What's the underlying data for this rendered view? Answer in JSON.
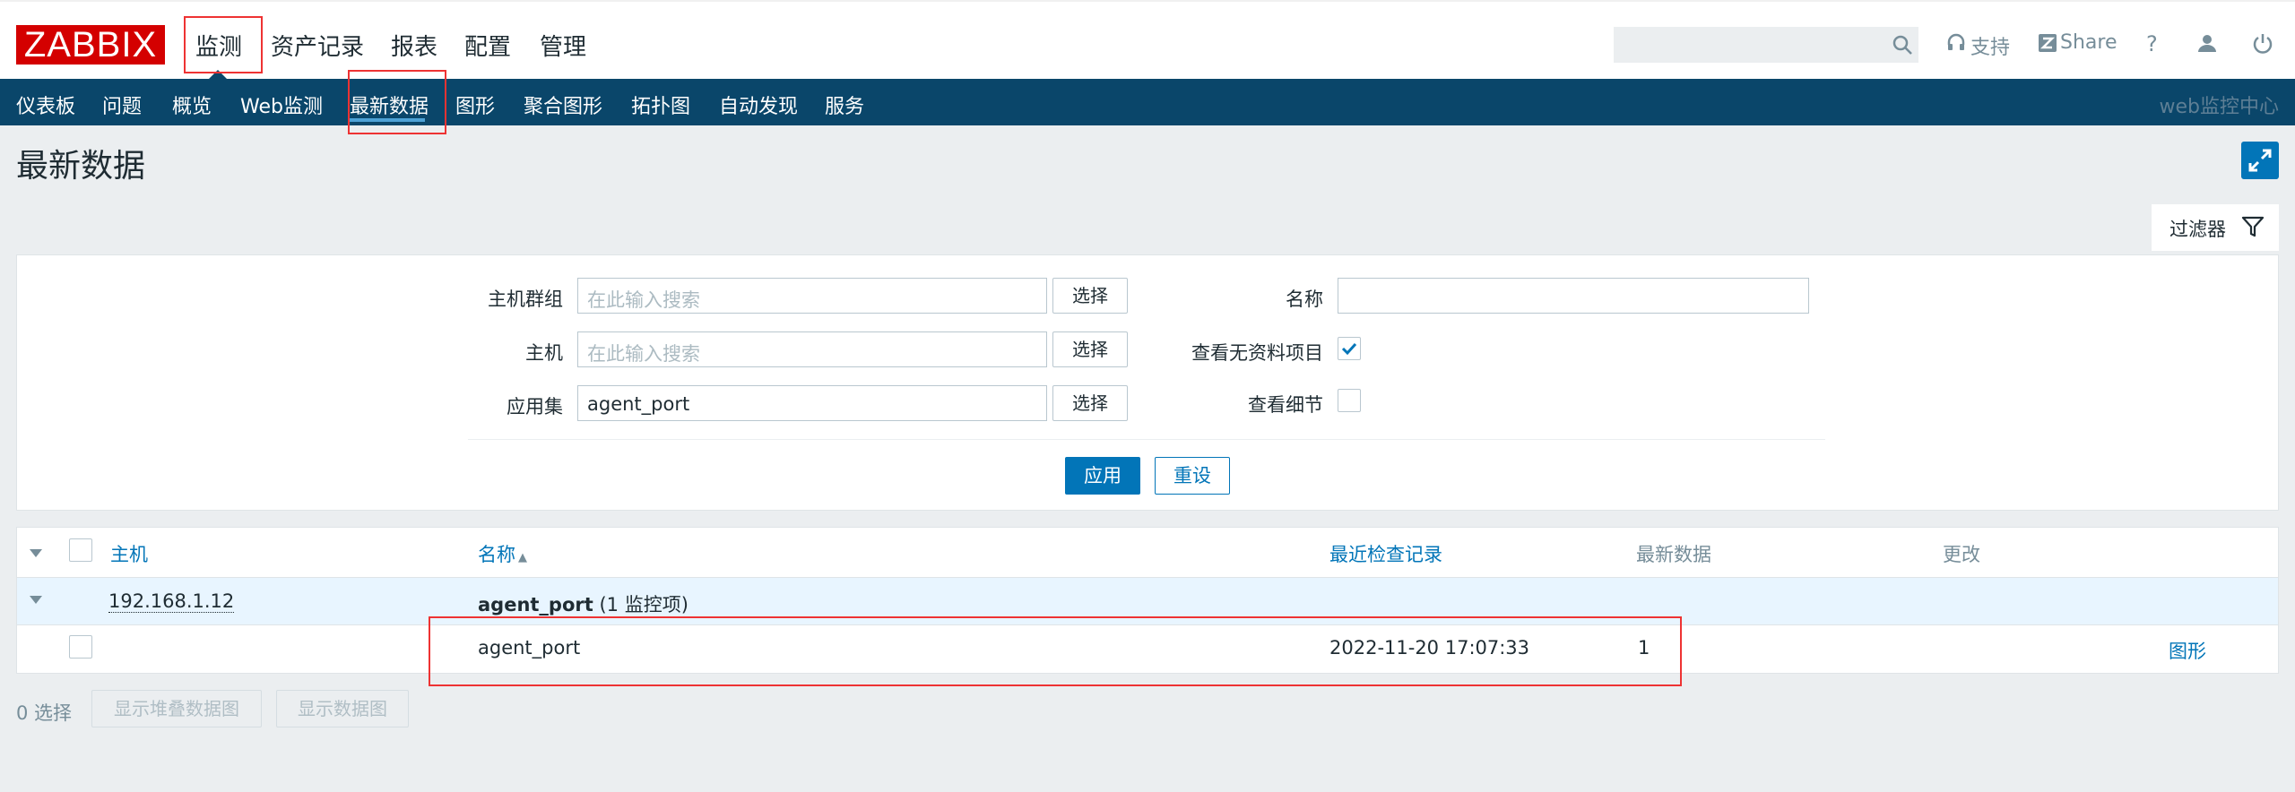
{
  "header": {
    "logo": "ZABBIX",
    "menu": [
      "监测",
      "资产记录",
      "报表",
      "配置",
      "管理"
    ],
    "search_placeholder": "",
    "support_label": "支持",
    "share_label": "Share",
    "help_label": "?"
  },
  "subnav": {
    "items": [
      "仪表板",
      "问题",
      "概览",
      "Web监测",
      "最新数据",
      "图形",
      "聚合图形",
      "拓扑图",
      "自动发现",
      "服务"
    ],
    "active": "最新数据",
    "right_label": "web监控中心"
  },
  "page": {
    "title": "最新数据"
  },
  "filter": {
    "tab_label": "过滤器",
    "host_group_label": "主机群组",
    "host_group_placeholder": "在此输入搜索",
    "host_label": "主机",
    "host_placeholder": "在此输入搜索",
    "app_label": "应用集",
    "app_value": "agent_port",
    "select_label": "选择",
    "name_label": "名称",
    "name_value": "",
    "show_without_data_label": "查看无资料项目",
    "show_without_data_checked": true,
    "show_details_label": "查看细节",
    "show_details_checked": false,
    "apply_label": "应用",
    "reset_label": "重设"
  },
  "table": {
    "headers": {
      "host": "主机",
      "name": "名称",
      "sort_arrow": "▲",
      "last_check": "最近检查记录",
      "last_value": "最新数据",
      "change": "更改"
    },
    "group": {
      "host": "192.168.1.12",
      "app_name": "agent_port",
      "app_count": "(1 监控项)"
    },
    "rows": [
      {
        "name": "agent_port",
        "last_check": "2022-11-20 17:07:33",
        "last_value": "1",
        "change": "",
        "action": "图形"
      }
    ]
  },
  "footer": {
    "selected": "0 选择",
    "btn_stacked": "显示堆叠数据图",
    "btn_graph": "显示数据图"
  },
  "colors": {
    "brand_red": "#d40000",
    "nav_blue": "#0a466a",
    "accent_blue": "#0275b8",
    "annotation_red": "#e33333"
  }
}
